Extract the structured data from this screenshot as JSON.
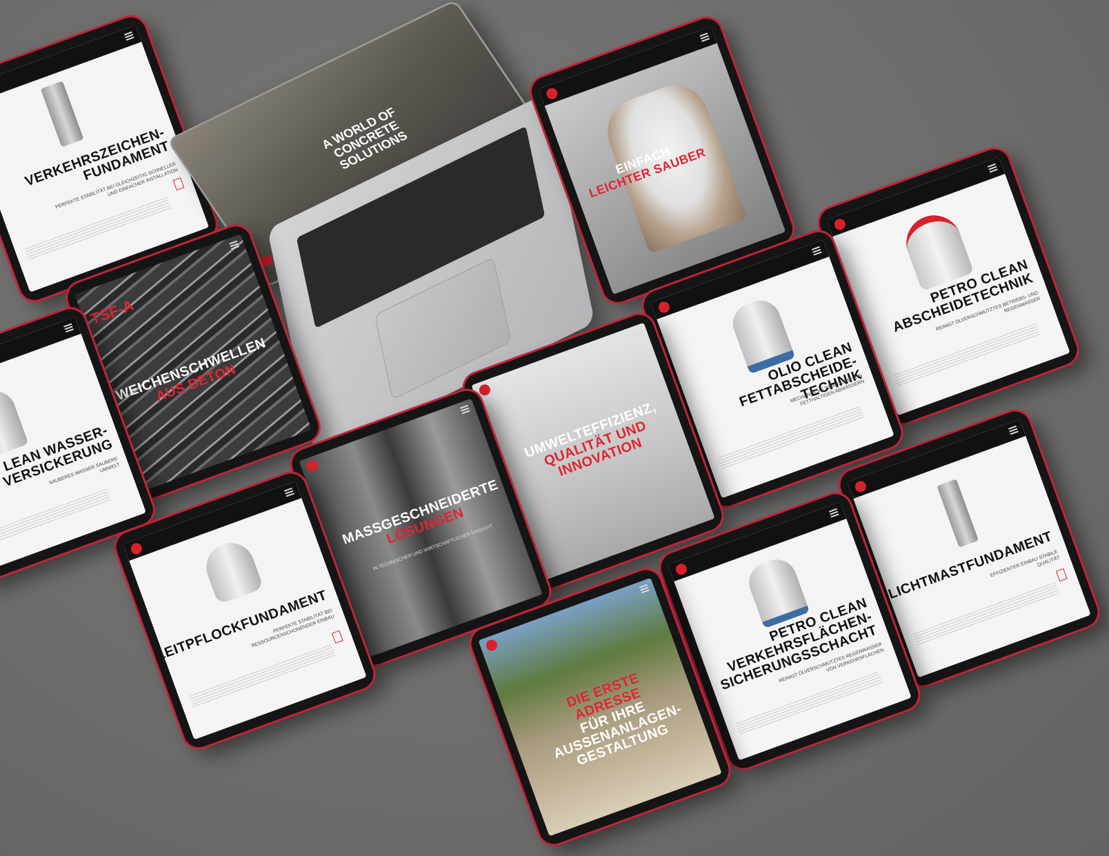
{
  "laptop": {
    "headline": "A WORLD OF CONCRETE SOLUTIONS"
  },
  "tablets": [
    {
      "key": "verkehrszeichen",
      "title_lines": [
        "VERKEHRSZEICHEN-",
        "FUNDAMENT"
      ],
      "subtitle": "PERFEKTE STABILITÄT BEI GLEICHZEITIG SCHNELLER UND EINFACHER INSTALLATION"
    },
    {
      "key": "einfach",
      "title_lines": [
        "EINFACH"
      ],
      "highlight": "LEICHTER SAUBER",
      "subtitle": ""
    },
    {
      "key": "tsf",
      "badge": "TSF-A",
      "title_lines": [
        "WEICHENSCHWELLEN"
      ],
      "highlight": "AUS BETON"
    },
    {
      "key": "wasser",
      "title_lines": [
        "LEAN WASSER-",
        "VERSICKERUNG"
      ],
      "subtitle": "SAUBERES WASSER SAUBERE UMWELT"
    },
    {
      "key": "petro_abscheide",
      "title_lines": [
        "PETRO CLEAN",
        "ABSCHEIDETECHNIK"
      ],
      "subtitle": "REINIGT ÖLVERSCHMUTZTES BETRIEBS- UND REGENWASSER"
    },
    {
      "key": "olio",
      "title_lines": [
        "OLIO CLEAN",
        "FETTABSCHEIDE-TECHNIK"
      ],
      "subtitle": "MECHANISCHE REINIGUNG VON FETTHALTIGEN ABWÄSSERN"
    },
    {
      "key": "umwelt",
      "title_lines": [
        "UMWELTEFFIZIENZ,"
      ],
      "highlight": "QUALITÄT UND INNOVATION"
    },
    {
      "key": "massgeschneiderte",
      "title_lines": [
        "MASSGESCHNEIDERTE"
      ],
      "highlight": "LÖSUNGEN",
      "subtitle": "IN TECHNISCHER UND WIRTSCHAFTLICHER HINSICHT"
    },
    {
      "key": "leitpflock",
      "title_lines": [
        "LEITPFLOCKFUNDAMENT"
      ],
      "subtitle": "PERFEKTE STABILITÄT BEI RESSOURCENSCHONENDER EINBAU"
    },
    {
      "key": "lichtmast",
      "title_lines": [
        "LICHTMASTFUNDAMENT"
      ],
      "subtitle": "EFFIZIENTER EINBAU STABILE QUALITÄT"
    },
    {
      "key": "petro_verkehr",
      "title_lines": [
        "PETRO CLEAN",
        "VERKEHRSFLÄCHEN-",
        "SICHERUNGSSCHACHT"
      ],
      "subtitle": "REINIGT ÖLVERSCHMUTZTES REGENWASSER VON VERKEHRSFLÄCHEN"
    },
    {
      "key": "garten",
      "title_lines": [
        "FÜR IHRE",
        "AUSSENANLAGEN-",
        "GESTALTUNG"
      ],
      "highlight": "DIE ERSTE ADRESSE"
    }
  ],
  "colors": {
    "brand_red": "#d7222c",
    "background": "#6f6e6c",
    "device": "#151515"
  }
}
